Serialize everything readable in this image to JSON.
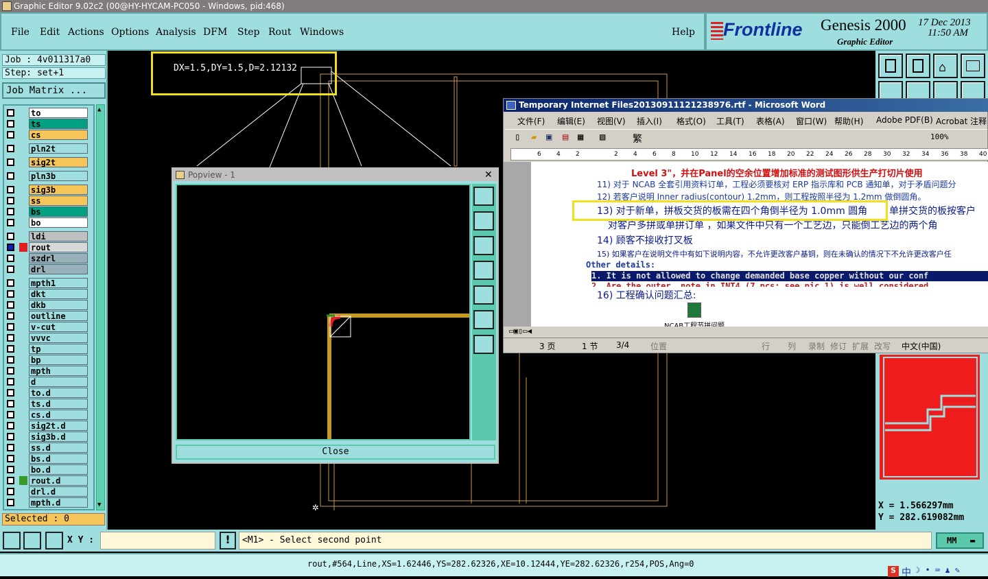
{
  "titlebar": {
    "title": "Graphic Editor 9.02c2 (00@HY-HYCAM-PC050 - Windows, pid:468)"
  },
  "menu": [
    "File",
    "Edit",
    "Actions",
    "Options",
    "Analysis",
    "DFM",
    "Step",
    "Rout",
    "Windows"
  ],
  "help": "Help",
  "brand": {
    "logo": "Frontline",
    "product": "Genesis 2000",
    "subtitle": "Graphic Editor",
    "date": "17 Dec 2013",
    "time": "11:50 AM"
  },
  "job": {
    "job_label": "Job : 4v011317a0",
    "step_label": "Step: set+1",
    "matrix_button": "Job Matrix ..."
  },
  "layers": [
    {
      "name": "to",
      "color": "#ffffff"
    },
    {
      "name": "ts",
      "color": "#00a080"
    },
    {
      "name": "cs",
      "color": "#f5c55a"
    },
    {
      "name": "pln2t",
      "color": "#9edede"
    },
    {
      "name": "sig2t",
      "color": "#f5c55a"
    },
    {
      "name": "pln3b",
      "color": "#9edede"
    },
    {
      "name": "sig3b",
      "color": "#f5c55a"
    },
    {
      "name": "ss",
      "color": "#f5c55a"
    },
    {
      "name": "bs",
      "color": "#00a080"
    },
    {
      "name": "bo",
      "color": "#ffffff"
    },
    {
      "name": "ldi",
      "color": "#c0c0c0"
    },
    {
      "name": "rout",
      "color": "#d8d8d8"
    },
    {
      "name": "szdrl",
      "color": "#98b0b8"
    },
    {
      "name": "drl",
      "color": "#98b0b8"
    },
    {
      "name": "mpth1",
      "color": "#9edede"
    },
    {
      "name": "dkt",
      "color": "#9edede"
    },
    {
      "name": "dkb",
      "color": "#9edede"
    },
    {
      "name": "outline",
      "color": "#9edede"
    },
    {
      "name": "v-cut",
      "color": "#9edede"
    },
    {
      "name": "vvvc",
      "color": "#9edede"
    },
    {
      "name": "tp",
      "color": "#9edede"
    },
    {
      "name": "bp",
      "color": "#9edede"
    },
    {
      "name": "mpth",
      "color": "#9edede"
    },
    {
      "name": "d",
      "color": "#9edede"
    },
    {
      "name": "to.d",
      "color": "#9edede"
    },
    {
      "name": "ts.d",
      "color": "#9edede"
    },
    {
      "name": "cs.d",
      "color": "#9edede"
    },
    {
      "name": "sig2t.d",
      "color": "#9edede"
    },
    {
      "name": "sig3b.d",
      "color": "#9edede"
    },
    {
      "name": "ss.d",
      "color": "#9edede"
    },
    {
      "name": "bs.d",
      "color": "#9edede"
    },
    {
      "name": "bo.d",
      "color": "#9edede"
    },
    {
      "name": "rout.d",
      "color": "#9edede"
    },
    {
      "name": "drl.d",
      "color": "#9edede"
    },
    {
      "name": "mpth.d",
      "color": "#9edede"
    }
  ],
  "selected": "Selected : 0",
  "measure": "DX=1.5,DY=1.5,D=2.12132",
  "popview": {
    "title": "Popview - 1",
    "close": "Close"
  },
  "word": {
    "title": "Temporary Internet Files20130911121238976.rtf - Microsoft Word",
    "menu": [
      "文件(F)",
      "编辑(E)",
      "视图(V)",
      "插入(I)",
      "格式(O)",
      "工具(T)",
      "表格(A)",
      "窗口(W)",
      "帮助(H)",
      "Adobe PDF(B)",
      "Acrobat 注释"
    ],
    "zoom": "100%",
    "ruler": [
      "6",
      "4",
      "2",
      "",
      "2",
      "4",
      "6",
      "8",
      "10",
      "12",
      "14",
      "16",
      "18",
      "20",
      "22",
      "24",
      "26",
      "28",
      "30",
      "32",
      "34",
      "36",
      "38",
      "40"
    ],
    "lines": [
      "Level 3\"，并在Panel的空余位置增加标准的测试图形供生产打切片使用",
      "11) 对于 NCAB 全套引用资料订单，工程必须要核对 ERP 指示库和 PCB 通知单，对于矛盾问题分",
      "12) 若客户说明 Inner radius(contour) 1.2mm，则工程按照半径为 1.2mm 做倒圆角。",
      "13) 对于新单，拼板交货的板需在四个角倒半径为 1.0mm 圆角",
      "单拼交货的板按客户",
      "对客户多拼或单拼订单 ，如果文件中只有一个工艺边，只能倒工艺边的两个角",
      "14) 顾客不接收打叉板",
      "15) 如果客户在说明文件中有如下说明内容，不允许更改客户基铜，则在未确认的情况下不允许更改客户任",
      "Other details:",
      "1. It is not allowed to change demanded base copper without our conf",
      "2. Are the outer, note in INT4 (7 pcs; see pic 1) is well considered",
      "16) 工程确认问题汇总:",
      "NCAB工程节拼问题"
    ],
    "status": [
      "3 页",
      "1 节",
      "3/4",
      "位置",
      "行",
      "列",
      "录制",
      "修订",
      "扩展",
      "改写",
      "中文(中国)"
    ]
  },
  "coords": {
    "x": "X = 1.566297mm",
    "y": "Y = 282.619082mm"
  },
  "bottom": {
    "xy_label": "X Y :",
    "prompt": "<M1> - Select second point",
    "units": "MM"
  },
  "status": "rout,#564,Line,XS=1.62446,YS=282.62326,XE=10.12444,YE=282.62326,r254,POS,Ang=0",
  "tray": "中"
}
